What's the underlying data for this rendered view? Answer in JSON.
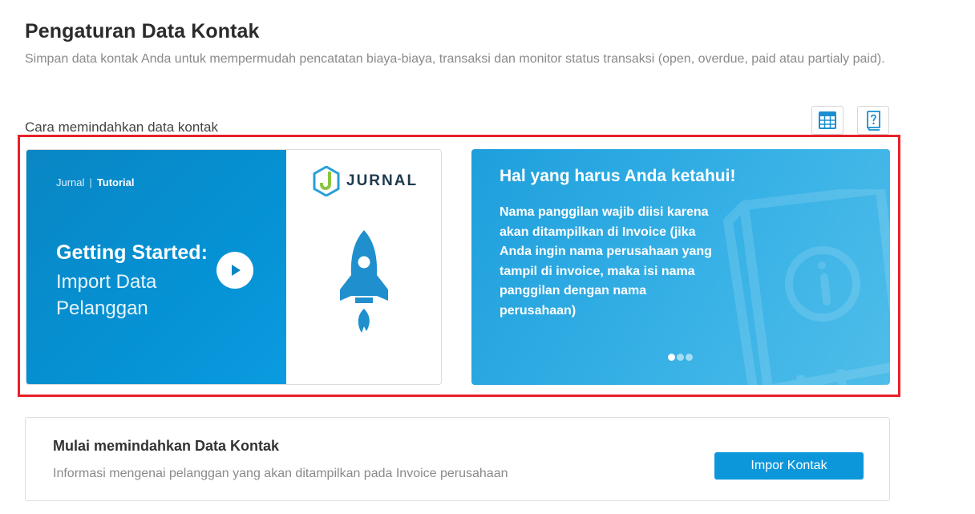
{
  "header": {
    "title": "Pengaturan Data Kontak",
    "description": "Simpan data kontak Anda untuk mempermudah pencatatan biaya-biaya, transaksi dan monitor status transaksi (open, overdue, paid atau partialy paid)."
  },
  "section": {
    "label": "Cara memindahkan data kontak"
  },
  "toolbar": {
    "icons": [
      "spreadsheet-icon",
      "help-book-icon"
    ]
  },
  "video_card": {
    "brand": "Jurnal",
    "separator": "|",
    "category": "Tutorial",
    "heading": "Getting Started:",
    "subheading": "Import Data Pelanggan",
    "logo_text": "JURNAL",
    "colors": {
      "primary": "#0592d4",
      "logo_green": "#8bc53f",
      "logo_blue": "#2a9fd8"
    }
  },
  "info_card": {
    "title": "Hal yang harus Anda ketahui!",
    "text": "Nama panggilan wajib diisi karena akan ditampilkan di Invoice (jika Anda ingin nama perusahaan yang tampil di invoice, maka isi nama panggilan dengan nama perusahaan)",
    "carousel": {
      "total": 3,
      "active": 1
    }
  },
  "import_panel": {
    "title": "Mulai memindahkan Data Kontak",
    "description": "Informasi mengenai pelanggan yang akan ditampilkan pada Invoice perusahaan",
    "button_label": "Impor Kontak"
  },
  "colors": {
    "accent": "#0d97db",
    "highlight_frame": "#e8202a"
  }
}
